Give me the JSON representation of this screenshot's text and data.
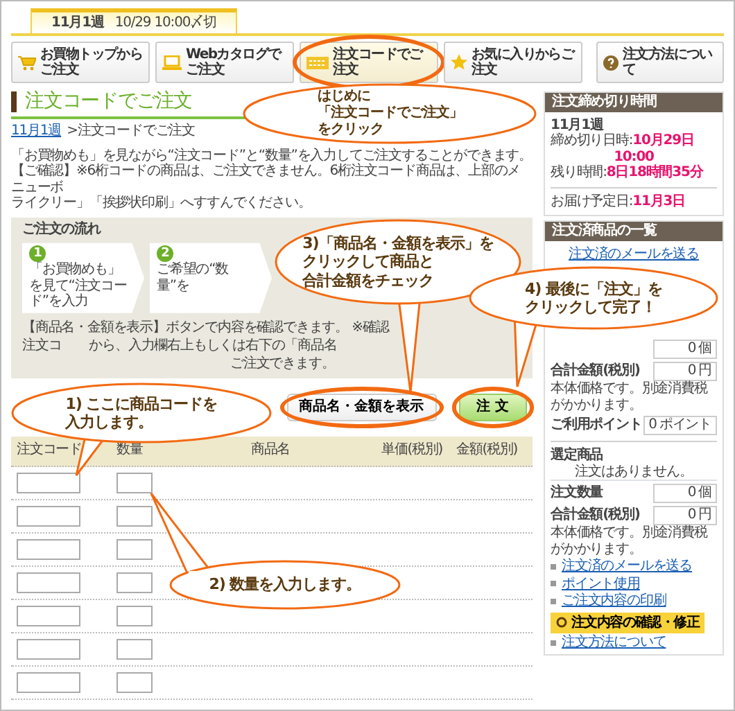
{
  "tab": {
    "label": "11月1週",
    "deadline": "10/29 10:00〆切",
    "selected": true
  },
  "nav": [
    {
      "label": "お買物トップからご注文",
      "selected": false,
      "highlighted": false
    },
    {
      "label": "Webカタログでご注文",
      "selected": false,
      "highlighted": false
    },
    {
      "label": "注文コードでご注文",
      "selected": true,
      "highlighted": true
    },
    {
      "label": "お気に入りからご注文",
      "selected": false,
      "highlighted": false
    }
  ],
  "help_button": {
    "label": "注文方法について"
  },
  "heading": "注文コードでご注文",
  "breadcrumb": {
    "link": "11月1週",
    "current": ">注文コードでご注文"
  },
  "intro": [
    "「お買物めも」を見ながら“注文コード”と“数量”を入力してご注文することができます。",
    "【ご確認】※6桁コードの商品は、ご注文できません。6桁注文コード商品は、上部のメニューボ",
    "ライクリー」「挨拶状印刷」へすすんでください。"
  ],
  "flow": {
    "title": "ご注文の流れ",
    "steps": [
      {
        "number": "1",
        "text": "「お買物めも」を見て“注文コード”を入力"
      },
      {
        "number": "2",
        "text": "ご希望の“数量”を"
      }
    ],
    "notes": [
      "【商品名・金額を表示】ボタンで内容を確認できます。 ※確認",
      "注文コ",
      "から、入力欄右上もしくは右下の「商品名",
      "ご注文できます。"
    ]
  },
  "actions": [
    {
      "label": "商品名・金額を表示",
      "kind": "plain",
      "highlighted": true
    },
    {
      "label": "注 文",
      "kind": "primary",
      "highlighted": true
    }
  ],
  "table": {
    "columns": [
      "注文コード",
      "数量",
      "商品名",
      "単価(税別)",
      "金額(税別)"
    ]
  },
  "sidebar": {
    "deadline_box": {
      "title": "注文締め切り時間",
      "week": "11月1週",
      "deadline_label": "締め切り日時:",
      "deadline_date": "10月29日",
      "deadline_time": "10:00",
      "remaining_label": "残り時間:",
      "remaining": "8日18時間35分",
      "delivery_label": "お届け予定日:",
      "delivery": "11月3日"
    },
    "ordered_box": {
      "title": "注文済商品の一覧",
      "top_link": "注文済のメールを送る",
      "fields_top": [
        {
          "value": "0",
          "unit": "個"
        },
        {
          "label": "合計金額(税別)",
          "value": "0",
          "unit": "円"
        }
      ],
      "note_top": "本体価格です。別途消費税がかかります。",
      "points": {
        "label": "ご利用ポイント",
        "value": "0",
        "unit": "ポイント"
      },
      "selected_title": "選定商品",
      "empty": "注文はありません。",
      "fields": [
        {
          "label": "注文数量",
          "value": "0",
          "unit": "個"
        },
        {
          "label": "合計金額(税別)",
          "value": "0",
          "unit": "円"
        }
      ],
      "note": "本体価格です。別途消費税がかかります。",
      "links": [
        "注文済のメールを送る",
        "ポイント使用",
        "ご注文内容の印刷"
      ],
      "confirm_button": "注文内容の確認・修正",
      "bottom_link": "注文方法について"
    }
  },
  "callouts": [
    {
      "lines": [
        "はじめに",
        "「注文コードでご注文」",
        "をクリック"
      ]
    },
    {
      "lines": [
        "3)「商品名・金額を表示」を",
        "クリックして商品と",
        "合計金額をチェック"
      ]
    },
    {
      "lines": [
        "4) 最後に「注文」を",
        "クリックして完了！"
      ]
    },
    {
      "lines": [
        "1) ここに商品コードを",
        "入力します。"
      ]
    },
    {
      "lines": [
        "2) 数量を入力します。"
      ]
    }
  ]
}
